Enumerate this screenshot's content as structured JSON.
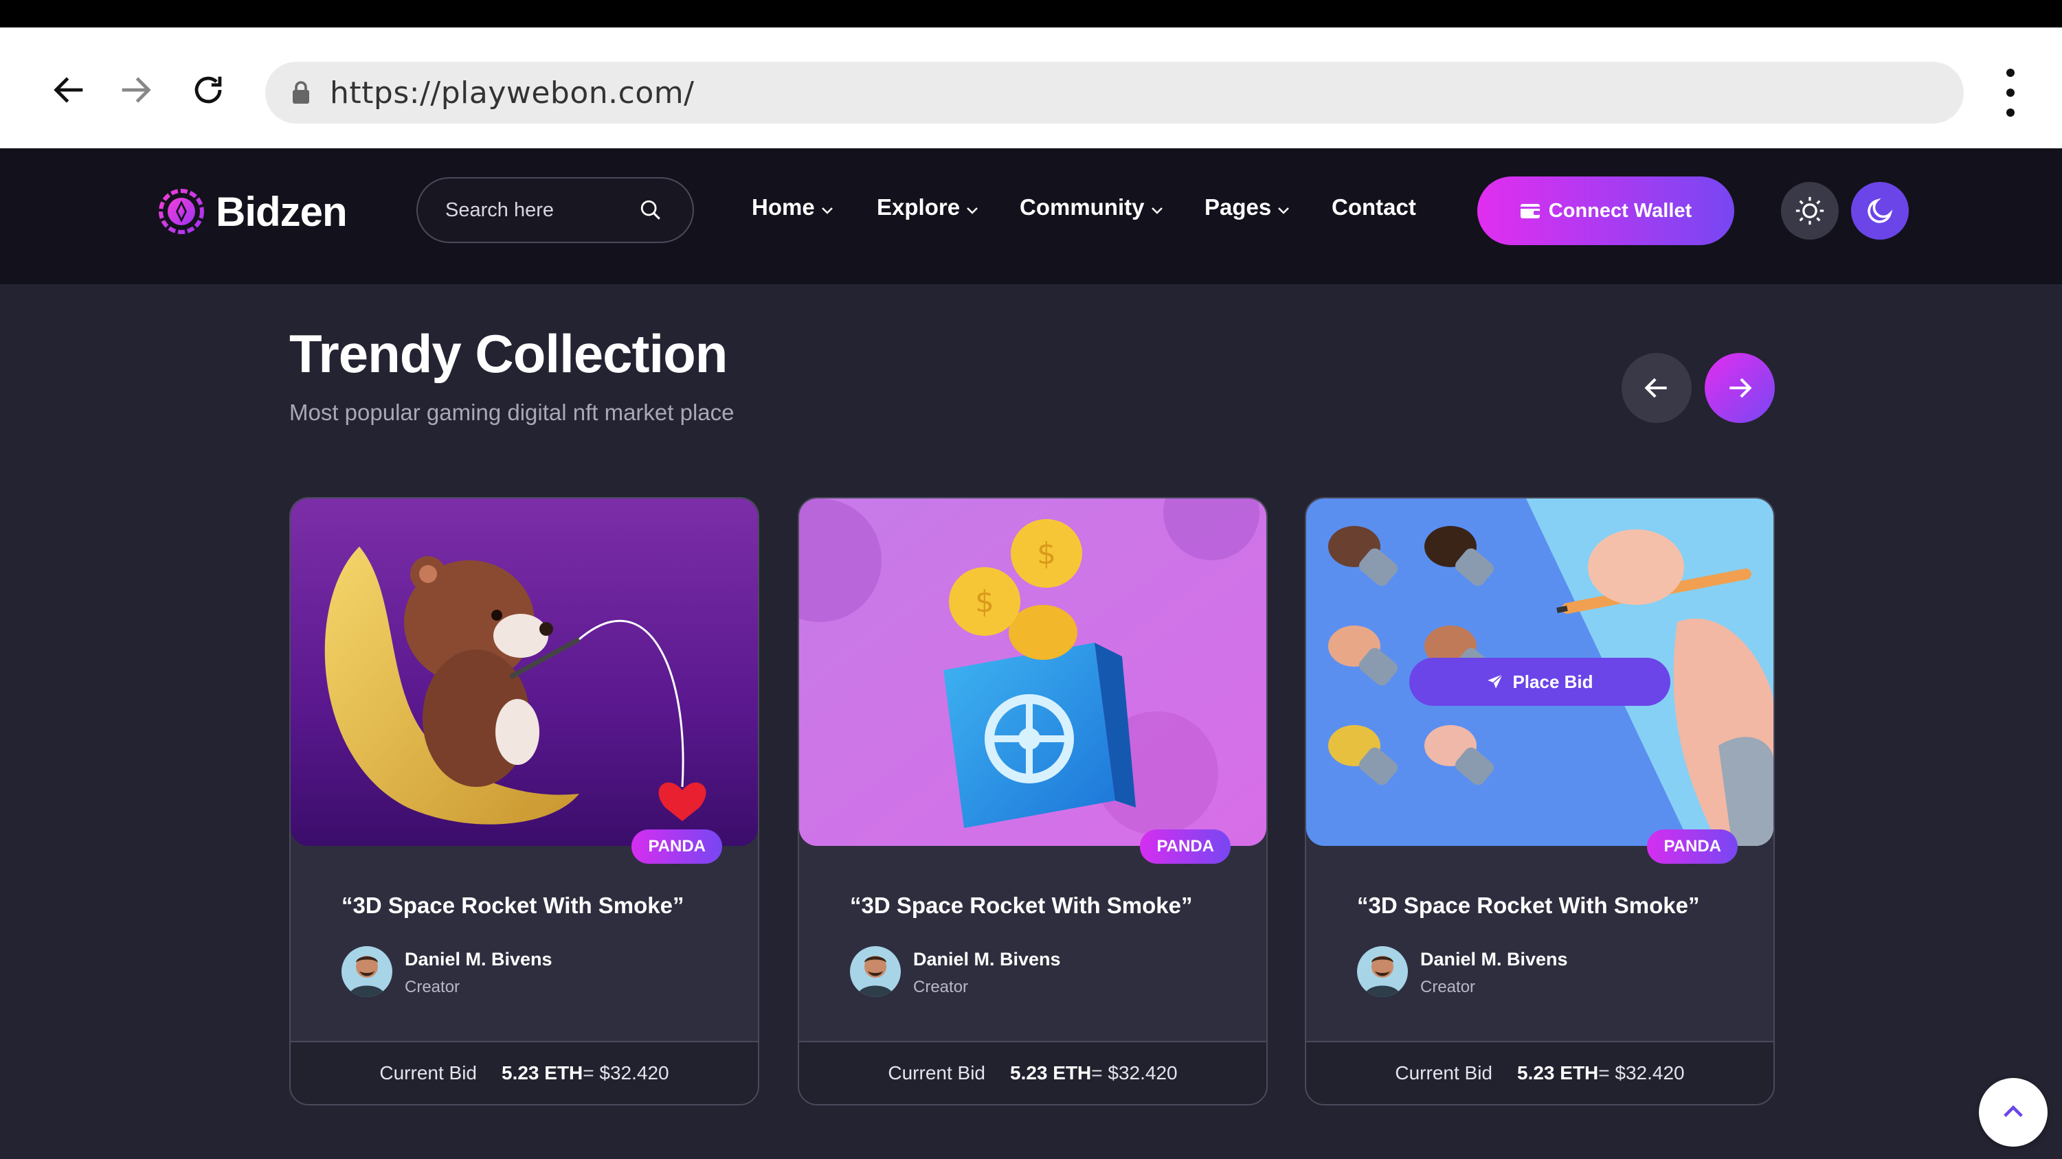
{
  "browser": {
    "url": "https://playwebon.com/"
  },
  "header": {
    "logo_text": "Bidzen",
    "search_placeholder": "Search here",
    "nav": [
      {
        "label": "Home"
      },
      {
        "label": "Explore"
      },
      {
        "label": "Community"
      },
      {
        "label": "Pages"
      },
      {
        "label": "Contact"
      }
    ],
    "connect_label": "Connect Wallet"
  },
  "section": {
    "title": "Trendy Collection",
    "subtitle": "Most popular gaming digital nft market place"
  },
  "cards": [
    {
      "badge": "PANDA",
      "title": "“3D Space Rocket With Smoke”",
      "creator": "Daniel M. Bivens",
      "role": "Creator",
      "bid_label": "Current Bid",
      "eth": "5.23 ETH",
      "usd": "= $32.420"
    },
    {
      "badge": "PANDA",
      "title": "“3D Space Rocket With Smoke”",
      "creator": "Daniel M. Bivens",
      "role": "Creator",
      "bid_label": "Current Bid",
      "eth": "5.23 ETH",
      "usd": "= $32.420"
    },
    {
      "badge": "PANDA",
      "title": "“3D Space Rocket With Smoke”",
      "creator": "Daniel M. Bivens",
      "role": "Creator",
      "bid_label": "Current Bid",
      "eth": "5.23 ETH",
      "usd": "= $32.420",
      "place_bid": "Place Bid"
    }
  ],
  "colors": {
    "accent_pink": "#e22ef0",
    "accent_purple": "#7747f2",
    "header_bg": "#13121c",
    "page_bg": "#242331",
    "card_bg": "#2f2e3f"
  }
}
